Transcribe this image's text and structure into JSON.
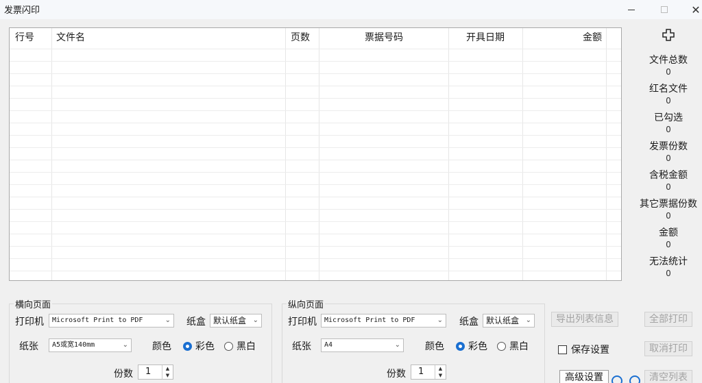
{
  "window": {
    "title": "发票闪印"
  },
  "grid": {
    "columns": [
      "行号",
      "文件名",
      "页数",
      "票据号码",
      "开具日期",
      "金额"
    ],
    "rows": []
  },
  "stats": [
    {
      "label": "文件总数",
      "value": "0"
    },
    {
      "label": "红名文件",
      "value": "0"
    },
    {
      "label": "已勾选",
      "value": "0"
    },
    {
      "label": "发票份数",
      "value": "0"
    },
    {
      "label": "含税金额",
      "value": "0"
    },
    {
      "label": "其它票据份数",
      "value": "0"
    },
    {
      "label": "金额",
      "value": "0"
    },
    {
      "label": "无法统计",
      "value": "0"
    }
  ],
  "landscape": {
    "title": "横向页面",
    "printer_label": "打印机",
    "printer_value": "Microsoft Print to PDF",
    "tray_label": "纸盒",
    "tray_value": "默认纸盒",
    "paper_label": "纸张",
    "paper_value": "A5或宽140mm",
    "color_label": "颜色",
    "color_option": "彩色",
    "bw_option": "黑白",
    "selected": "color",
    "copies_label": "份数",
    "copies_value": "1"
  },
  "portrait": {
    "title": "纵向页面",
    "printer_label": "打印机",
    "printer_value": "Microsoft Print to PDF",
    "tray_label": "纸盒",
    "tray_value": "默认纸盒",
    "paper_label": "纸张",
    "paper_value": "A4",
    "color_label": "颜色",
    "color_option": "彩色",
    "bw_option": "黑白",
    "selected": "color",
    "copies_label": "份数",
    "copies_value": "1"
  },
  "actions": {
    "export_list": "导出列表信息",
    "save_settings": "保存设置",
    "advanced": "高级设置",
    "print_all": "全部打印",
    "cancel_print": "取消打印",
    "clear_list": "清空列表"
  },
  "icons": {
    "add": "plus-icon"
  },
  "colors": {
    "accent": "#1a6fd1"
  }
}
